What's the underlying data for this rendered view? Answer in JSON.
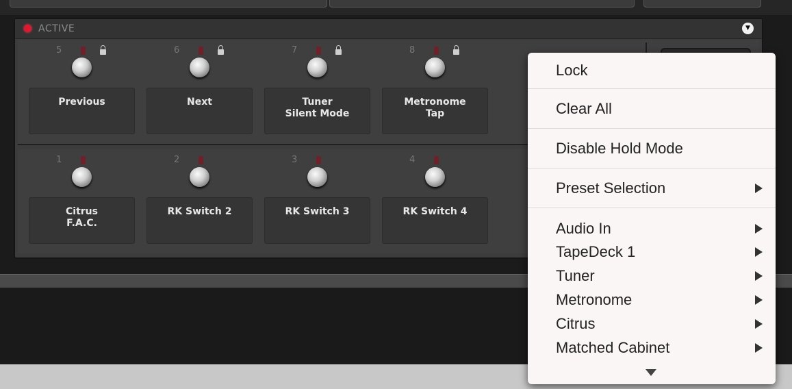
{
  "header": {
    "status_label": "ACTIVE"
  },
  "upper_row": [
    {
      "num": "5",
      "label_lines": [
        "Previous"
      ]
    },
    {
      "num": "6",
      "label_lines": [
        "Next"
      ]
    },
    {
      "num": "7",
      "label_lines": [
        "Tuner",
        "Silent Mode"
      ]
    },
    {
      "num": "8",
      "label_lines": [
        "Metronome",
        "Tap"
      ]
    }
  ],
  "lower_row": [
    {
      "num": "1",
      "label_lines": [
        "Citrus",
        "F.A.C."
      ]
    },
    {
      "num": "2",
      "label_lines": [
        "RK Switch 2"
      ]
    },
    {
      "num": "3",
      "label_lines": [
        "RK Switch 3"
      ]
    },
    {
      "num": "4",
      "label_lines": [
        "RK Switch 4"
      ]
    }
  ],
  "context_menu": {
    "lock": "Lock",
    "clear_all": "Clear All",
    "disable_hold": "Disable Hold Mode",
    "preset_selection": "Preset Selection",
    "items": [
      "Audio In",
      "TapeDeck 1",
      "Tuner",
      "Metronome",
      "Citrus",
      "Matched Cabinet"
    ]
  },
  "colors": {
    "active_led": "#e2162e",
    "panel": "#3c3c3c",
    "menu_bg": "#fbf6f6"
  },
  "icons": [
    "lock-icon",
    "knob",
    "led",
    "dropdown-arrow-icon",
    "submenu-arrow-icon"
  ]
}
